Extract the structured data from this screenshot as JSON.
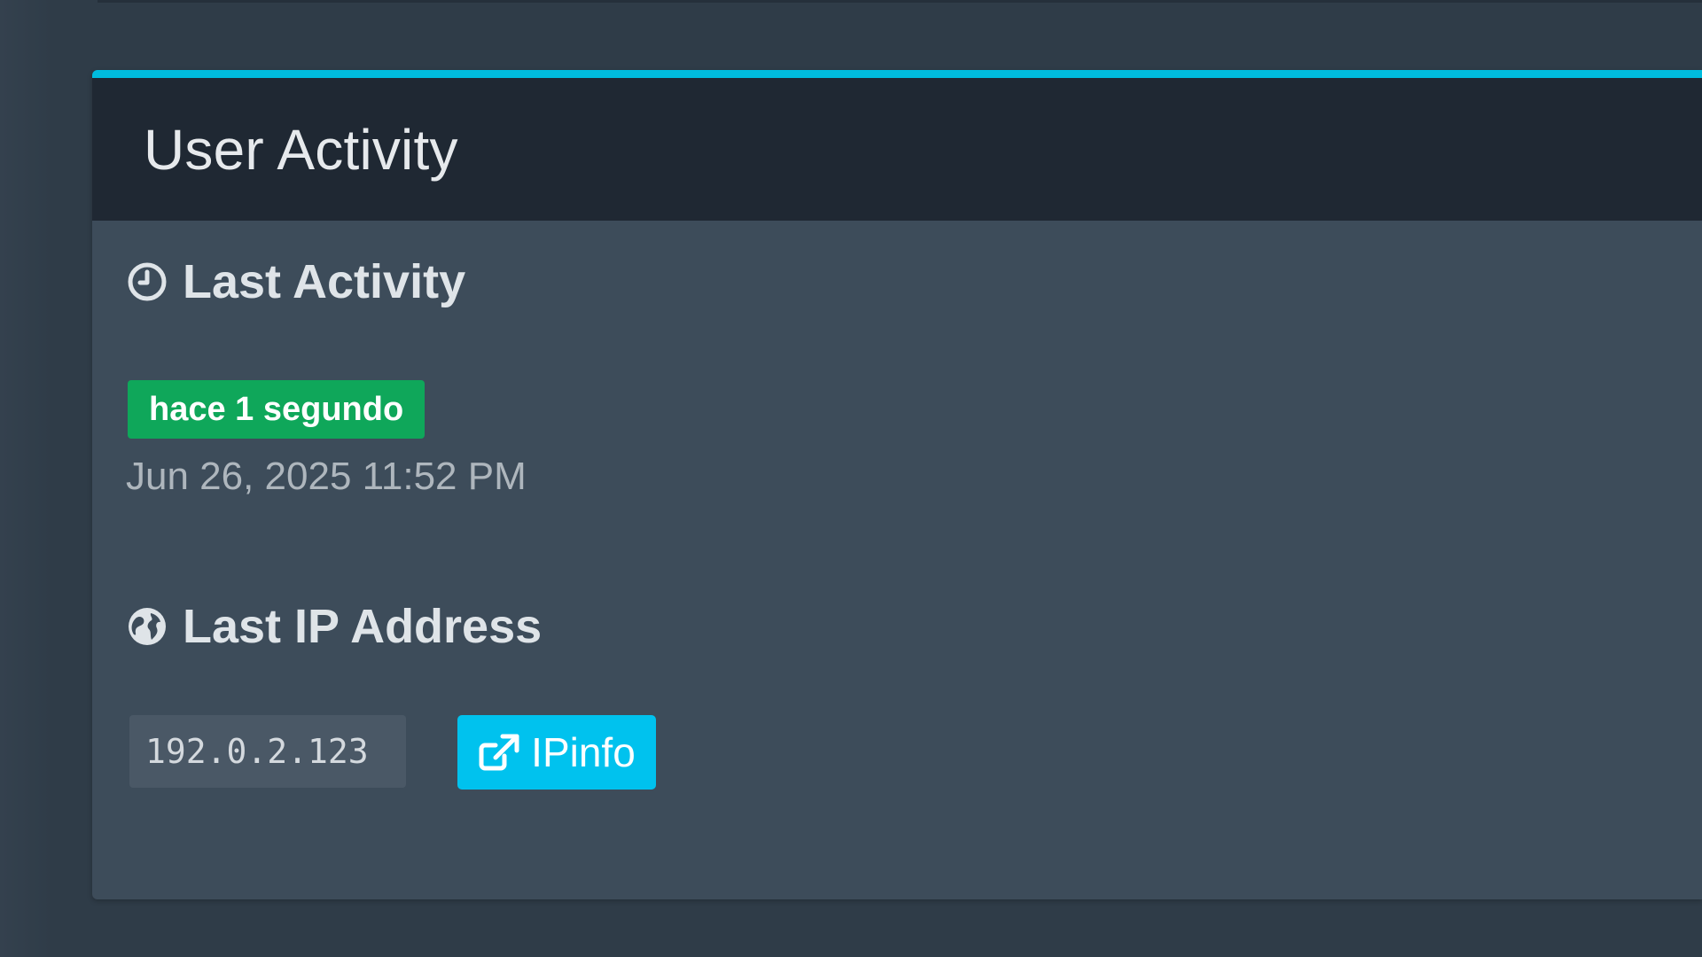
{
  "card": {
    "title": "User Activity"
  },
  "last_activity": {
    "heading": "Last Activity",
    "icon": "clock-icon",
    "relative_time": "hace 1 segundo",
    "timestamp": "Jun 26, 2025 11:52 PM"
  },
  "last_ip": {
    "heading": "Last IP Address",
    "icon": "globe-icon",
    "address": "192.0.2.123",
    "button_label": "IPinfo",
    "button_icon": "external-link-icon"
  },
  "colors": {
    "accent": "#00bcde",
    "badge_success": "#0fa75a",
    "button_info": "#00c2ee",
    "header_bg": "#1f2833",
    "body_bg": "#3d4c5a"
  }
}
